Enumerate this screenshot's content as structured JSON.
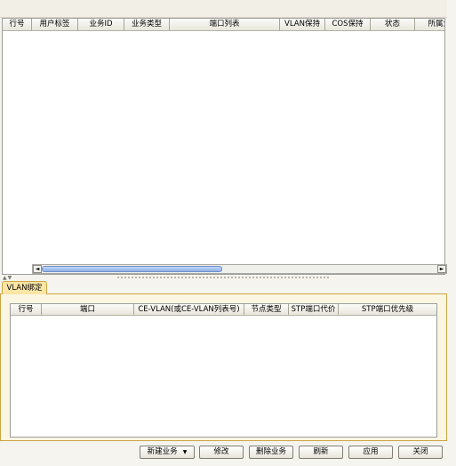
{
  "main_table": {
    "columns": [
      "行号",
      "用户标签",
      "业务ID",
      "业务类型",
      "端口列表",
      "VLAN保持",
      "COS保持",
      "状态",
      "所属业"
    ],
    "rows": []
  },
  "scrollbar": {
    "left_arrow": "◄",
    "right_arrow": "►"
  },
  "splitter": {
    "collapse_arrows": "▲▼"
  },
  "tabs": [
    {
      "label": "VLAN绑定",
      "active": true
    }
  ],
  "sub_table": {
    "columns": [
      "行号",
      "端口",
      "CE-VLAN(或CE-VLAN列表号)",
      "节点类型",
      "STP端口代价",
      "STP端口优先级"
    ],
    "rows": []
  },
  "buttons": {
    "new_service": "新建业务",
    "new_service_caret": "▼",
    "modify": "修改",
    "delete_service": "删除业务",
    "refresh": "刷新",
    "apply": "应用",
    "close": "关闭"
  },
  "colors": {
    "tab_active": "#fbe6a6",
    "panel_bg": "#fbf6e1",
    "scroll_thumb": "#8eb0e8"
  }
}
